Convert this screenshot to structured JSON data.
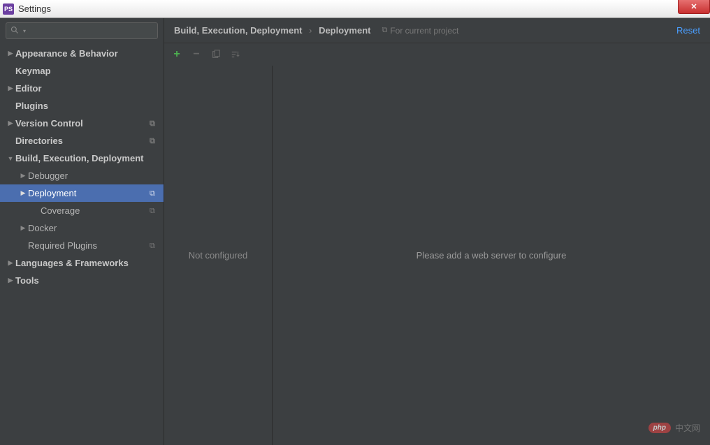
{
  "window": {
    "title": "Settings",
    "app_icon_text": "PS"
  },
  "breadcrumb": {
    "parent": "Build, Execution, Deployment",
    "current": "Deployment",
    "for_project": "For current project",
    "reset": "Reset"
  },
  "sidebar": {
    "items": [
      {
        "label": "Appearance & Behavior",
        "level": 0,
        "arrow": "right",
        "bold": true
      },
      {
        "label": "Keymap",
        "level": 0,
        "bold": true
      },
      {
        "label": "Editor",
        "level": 0,
        "arrow": "right",
        "bold": true
      },
      {
        "label": "Plugins",
        "level": 0,
        "bold": true
      },
      {
        "label": "Version Control",
        "level": 0,
        "arrow": "right",
        "bold": true,
        "copy": true
      },
      {
        "label": "Directories",
        "level": 0,
        "bold": true,
        "copy": true
      },
      {
        "label": "Build, Execution, Deployment",
        "level": 0,
        "arrow": "down",
        "bold": true
      },
      {
        "label": "Debugger",
        "level": 1,
        "arrow": "right"
      },
      {
        "label": "Deployment",
        "level": 1,
        "arrow": "right",
        "copy": true,
        "selected": true
      },
      {
        "label": "Coverage",
        "level": 2,
        "copy": true
      },
      {
        "label": "Docker",
        "level": 1,
        "arrow": "right"
      },
      {
        "label": "Required Plugins",
        "level": 1,
        "copy": true
      },
      {
        "label": "Languages & Frameworks",
        "level": 0,
        "arrow": "right",
        "bold": true
      },
      {
        "label": "Tools",
        "level": 0,
        "arrow": "right",
        "bold": true
      }
    ]
  },
  "panel": {
    "left_text": "Not configured",
    "right_text": "Please add a web server to configure"
  },
  "watermark": {
    "pill": "php",
    "text": "中文网"
  }
}
